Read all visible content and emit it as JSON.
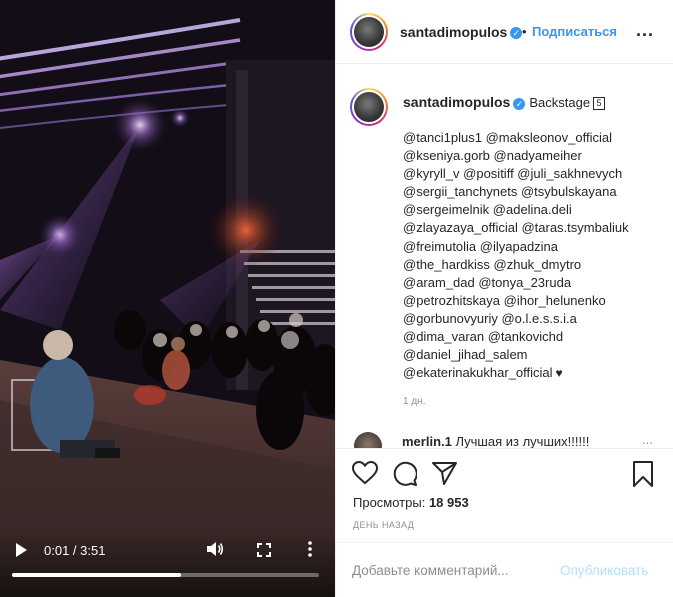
{
  "video": {
    "time_current": "0:01",
    "time_total": "3:51",
    "progress": 0.55,
    "time_separator": " / "
  },
  "post": {
    "username": "santadimopulos",
    "follow_label": "Подписаться",
    "dot": "•",
    "more": "...",
    "caption_title": "Backstage",
    "caption_badge": "5",
    "mention_lines": [
      "@tanci1plus1 @maksleonov_official",
      "@kseniya.gorb @nadyameiher",
      "@kyryll_v @positiff @juli_sakhnevych",
      "@sergii_tanchynets @tsybulskayana",
      "@sergeimelnik @adelina.deli",
      "@zlayazaya_official @taras.tsymbaliuk",
      "@freimutolia @ilyapadzina",
      "@the_hardkiss @zhuk_dmytro",
      "@aram_dad @tonya_23ruda",
      "@petrozhitskaya @ihor_helunenko",
      "@gorbunovyuriy @o.l.e.s.s.i.a",
      "@dima_varan @tankovichd",
      "@daniel_jihad_salem",
      "@ekaterinakukhar_official"
    ],
    "heart": "♥",
    "ago": "1 дн.",
    "comment": {
      "user": "merlin.1",
      "text": "Лучшая из лучших!!!!!!",
      "more": "..."
    },
    "views_label": "Просмотры:",
    "views_count": "18 953",
    "date": "ДЕНЬ НАЗАД"
  },
  "comment_box": {
    "placeholder": "Добавьте комментарий...",
    "post_label": "Опубликовать"
  },
  "icons": {
    "play": "play-icon",
    "volume": "volume-icon",
    "fullscreen": "fullscreen-icon",
    "options": "more-vertical-icon",
    "like": "heart-icon",
    "comment": "comment-icon",
    "share": "send-icon",
    "save": "bookmark-icon",
    "verified": "verified-badge-icon"
  },
  "colors": {
    "accent": "#3897f0",
    "post_disabled": "#b2dffc",
    "muted": "#8e8e8e"
  }
}
